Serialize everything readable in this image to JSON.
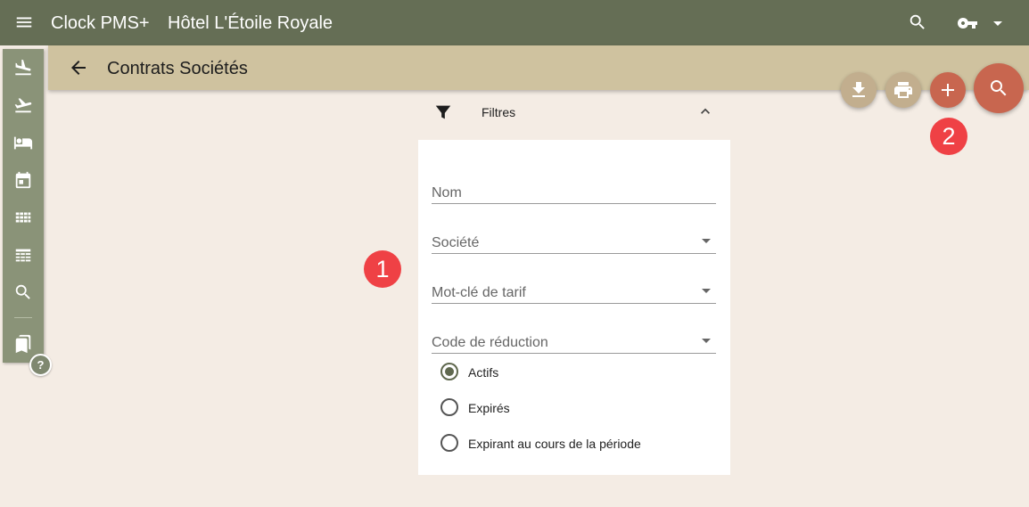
{
  "colors": {
    "topbar": "#656e55",
    "subheader": "#cfc29f",
    "sidebar": "#8a9378",
    "background": "#f4ece4",
    "fab_secondary": "#c2ae8e",
    "fab_primary": "#c8664f",
    "marker": "#ef4145",
    "radio_checked": "#5f684e"
  },
  "topbar": {
    "app_name": "Clock PMS+",
    "hotel_name": "Hôtel L'Étoile Royale",
    "icons": [
      "menu-icon",
      "search-icon",
      "key-icon",
      "caret-down-icon"
    ]
  },
  "subheader": {
    "title": "Contrats Sociétés",
    "back_icon": "arrow-left-icon"
  },
  "sidebar": {
    "items": [
      {
        "icon": "flight-land-icon"
      },
      {
        "icon": "flight-takeoff-icon"
      },
      {
        "icon": "hotel-bed-icon"
      },
      {
        "icon": "calendar-icon"
      },
      {
        "icon": "grid-icon"
      },
      {
        "icon": "table-view-icon"
      },
      {
        "icon": "search-icon"
      },
      {
        "icon": "bookmarks-icon"
      }
    ],
    "help_label": "?"
  },
  "filters": {
    "header_label": "Filtres",
    "fields": [
      {
        "label": "Nom",
        "type": "text"
      },
      {
        "label": "Société",
        "type": "select"
      },
      {
        "label": "Mot-clé de tarif",
        "type": "select"
      },
      {
        "label": "Code de réduction",
        "type": "select"
      }
    ],
    "status_options": [
      {
        "label": "Actifs",
        "checked": true
      },
      {
        "label": "Expirés",
        "checked": false
      },
      {
        "label": "Expirant au cours de la période",
        "checked": false
      }
    ]
  },
  "fabs": [
    "download-icon",
    "print-icon",
    "add-icon",
    "search-icon"
  ],
  "markers": [
    "1",
    "2"
  ]
}
